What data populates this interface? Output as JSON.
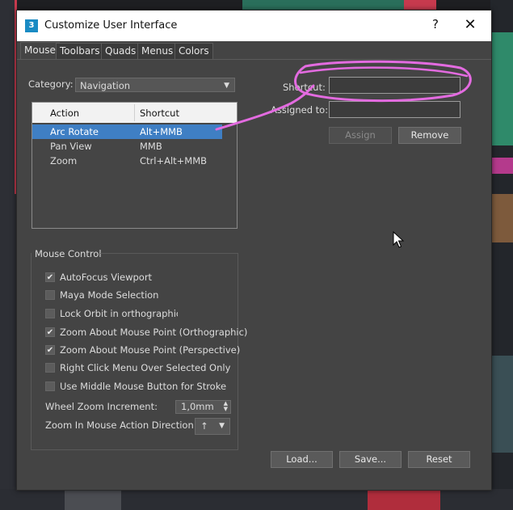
{
  "window": {
    "app_icon_glyph": "3",
    "title": "Customize User Interface",
    "help_glyph": "?",
    "close_glyph": "✕"
  },
  "tabs": [
    {
      "label": "Mouse",
      "active": true
    },
    {
      "label": "Toolbars",
      "active": false
    },
    {
      "label": "Quads",
      "active": false
    },
    {
      "label": "Menus",
      "active": false
    },
    {
      "label": "Colors",
      "active": false
    }
  ],
  "category": {
    "label": "Category:",
    "value": "Navigation"
  },
  "actions_table": {
    "headers": [
      "Action",
      "Shortcut"
    ],
    "rows": [
      {
        "action": "Arc Rotate",
        "shortcut": "Alt+MMB",
        "selected": true
      },
      {
        "action": "Pan View",
        "shortcut": "MMB",
        "selected": false
      },
      {
        "action": "Zoom",
        "shortcut": "Ctrl+Alt+MMB",
        "selected": false
      }
    ]
  },
  "shortcut": {
    "label": "Shortcut:",
    "value": ""
  },
  "assigned_to": {
    "label": "Assigned to:",
    "value": ""
  },
  "buttons": {
    "assign": "Assign",
    "remove": "Remove",
    "load": "Load...",
    "save": "Save...",
    "reset": "Reset"
  },
  "mouse_control": {
    "title": "Mouse Control",
    "checkboxes": [
      {
        "label": "AutoFocus Viewport",
        "checked": true
      },
      {
        "label": "Maya Mode Selection",
        "checked": false
      },
      {
        "label": "Lock Orbit in orthographic vie",
        "checked": false
      },
      {
        "label": "Zoom About Mouse Point (Orthographic)",
        "checked": true
      },
      {
        "label": "Zoom About Mouse Point (Perspective)",
        "checked": true
      },
      {
        "label": "Right Click Menu Over Selected Only",
        "checked": false
      },
      {
        "label": "Use Middle Mouse Button for Stroke",
        "checked": false
      }
    ],
    "wheel_zoom_label": "Wheel Zoom Increment:",
    "wheel_zoom_value": "1,0mm",
    "zoom_direction_label": "Zoom In Mouse Action Direction:",
    "zoom_direction_value": "↑"
  },
  "colors": {
    "accent_selection": "#3f7fc4",
    "annotation": "#e36be0",
    "dialog_bg": "#444444"
  }
}
